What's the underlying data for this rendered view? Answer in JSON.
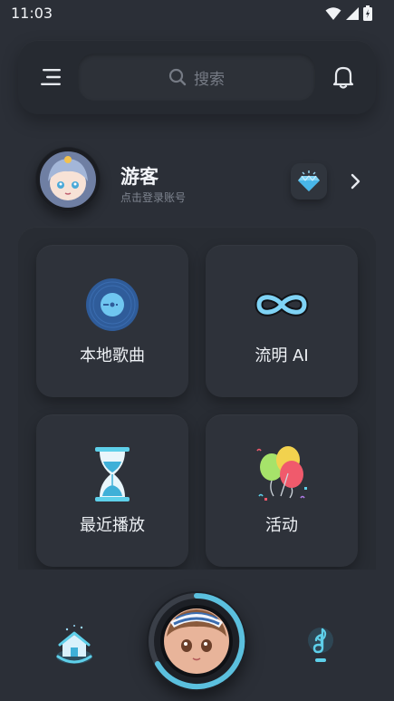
{
  "status": {
    "time": "11:03"
  },
  "search": {
    "placeholder": "搜索"
  },
  "profile": {
    "name": "游客",
    "subtitle": "点击登录账号"
  },
  "cards": [
    {
      "label": "本地歌曲",
      "icon": "vinyl-record-icon"
    },
    {
      "label": "流明 AI",
      "icon": "infinity-icon"
    },
    {
      "label": "最近播放",
      "icon": "hourglass-icon"
    },
    {
      "label": "活动",
      "icon": "balloons-icon"
    }
  ],
  "colors": {
    "background": "#2b2f37",
    "accent": "#5bc0de",
    "panel": "#282c33"
  }
}
